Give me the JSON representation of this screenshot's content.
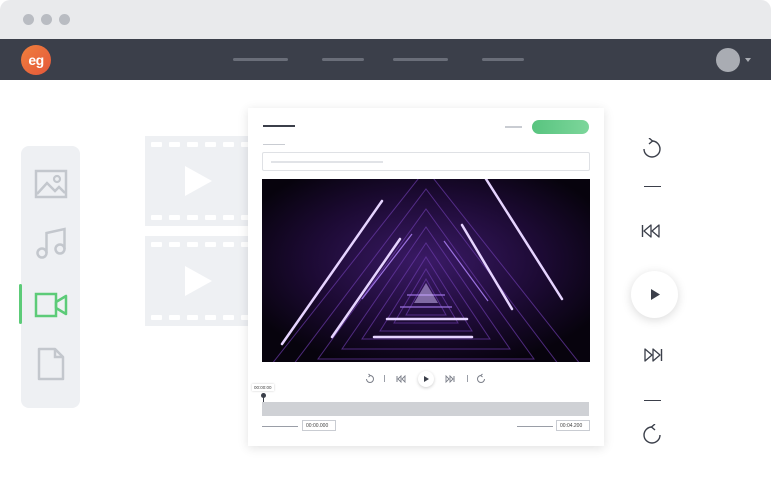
{
  "app": {
    "logo_text": "eg"
  },
  "sidebar": {
    "items": [
      {
        "icon": "image-icon",
        "active": false
      },
      {
        "icon": "music-icon",
        "active": false
      },
      {
        "icon": "video-icon",
        "active": true
      },
      {
        "icon": "document-icon",
        "active": false
      }
    ]
  },
  "editor": {
    "playhead_time": "00:00:00",
    "start_time": "00:00.000",
    "end_time": "00:04.200"
  },
  "colors": {
    "topbar": "#3b3f4a",
    "accent_green": "#5ccb78",
    "sidebar_bg": "#eef0f3",
    "logo_orange": "#e4573b"
  }
}
